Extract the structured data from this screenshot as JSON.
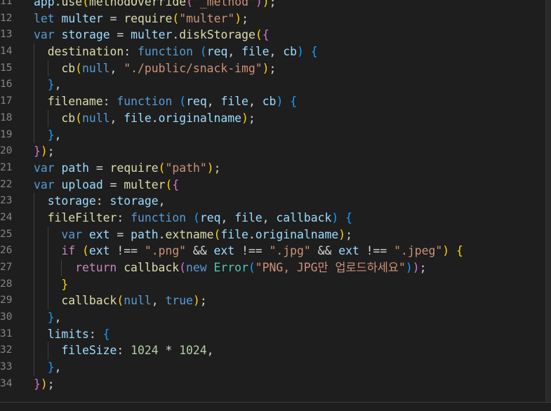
{
  "editor": {
    "lines": [
      {
        "n": "11",
        "indent": 0,
        "tokens": [
          [
            "var",
            "app"
          ],
          [
            "pun",
            "."
          ],
          [
            "fn",
            "use"
          ],
          [
            "b1",
            "("
          ],
          [
            "fn",
            "methodOverride"
          ],
          [
            "b2",
            "("
          ],
          [
            "str",
            "\"_method\""
          ],
          [
            "b2",
            ")"
          ],
          [
            "b1",
            ")"
          ],
          [
            "pun",
            ";"
          ]
        ]
      },
      {
        "n": "12",
        "indent": 0,
        "tokens": [
          [
            "kw",
            "let"
          ],
          [
            "pun",
            " "
          ],
          [
            "var",
            "multer"
          ],
          [
            "pun",
            " = "
          ],
          [
            "fn",
            "require"
          ],
          [
            "b1",
            "("
          ],
          [
            "str",
            "\"multer\""
          ],
          [
            "b1",
            ")"
          ],
          [
            "pun",
            ";"
          ]
        ]
      },
      {
        "n": "13",
        "indent": 0,
        "tokens": [
          [
            "kw",
            "var"
          ],
          [
            "pun",
            " "
          ],
          [
            "var",
            "storage"
          ],
          [
            "pun",
            " = "
          ],
          [
            "var",
            "multer"
          ],
          [
            "pun",
            "."
          ],
          [
            "fn",
            "diskStorage"
          ],
          [
            "b1",
            "("
          ],
          [
            "b2",
            "{"
          ]
        ]
      },
      {
        "n": "14",
        "indent": 1,
        "tokens": [
          [
            "fn",
            "destination"
          ],
          [
            "pun",
            ": "
          ],
          [
            "kw",
            "function"
          ],
          [
            "pun",
            " "
          ],
          [
            "b3",
            "("
          ],
          [
            "var",
            "req"
          ],
          [
            "pun",
            ", "
          ],
          [
            "var",
            "file"
          ],
          [
            "pun",
            ", "
          ],
          [
            "var",
            "cb"
          ],
          [
            "b3",
            ")"
          ],
          [
            "pun",
            " "
          ],
          [
            "b3",
            "{"
          ]
        ]
      },
      {
        "n": "15",
        "indent": 2,
        "tokens": [
          [
            "fn",
            "cb"
          ],
          [
            "b1",
            "("
          ],
          [
            "kw",
            "null"
          ],
          [
            "pun",
            ", "
          ],
          [
            "str",
            "\"./public/snack-img\""
          ],
          [
            "b1",
            ")"
          ],
          [
            "pun",
            ";"
          ]
        ]
      },
      {
        "n": "16",
        "indent": 1,
        "tokens": [
          [
            "b3",
            "}"
          ],
          [
            "pun",
            ","
          ]
        ]
      },
      {
        "n": "17",
        "indent": 1,
        "tokens": [
          [
            "fn",
            "filename"
          ],
          [
            "pun",
            ": "
          ],
          [
            "kw",
            "function"
          ],
          [
            "pun",
            " "
          ],
          [
            "b3",
            "("
          ],
          [
            "var",
            "req"
          ],
          [
            "pun",
            ", "
          ],
          [
            "var",
            "file"
          ],
          [
            "pun",
            ", "
          ],
          [
            "var",
            "cb"
          ],
          [
            "b3",
            ")"
          ],
          [
            "pun",
            " "
          ],
          [
            "b3",
            "{"
          ]
        ]
      },
      {
        "n": "18",
        "indent": 2,
        "tokens": [
          [
            "fn",
            "cb"
          ],
          [
            "b1",
            "("
          ],
          [
            "kw",
            "null"
          ],
          [
            "pun",
            ", "
          ],
          [
            "var",
            "file"
          ],
          [
            "pun",
            "."
          ],
          [
            "var",
            "originalname"
          ],
          [
            "b1",
            ")"
          ],
          [
            "pun",
            ";"
          ]
        ]
      },
      {
        "n": "19",
        "indent": 1,
        "tokens": [
          [
            "b3",
            "}"
          ],
          [
            "pun",
            ","
          ]
        ]
      },
      {
        "n": "20",
        "indent": 0,
        "tokens": [
          [
            "b2",
            "}"
          ],
          [
            "b1",
            ")"
          ],
          [
            "pun",
            ";"
          ]
        ]
      },
      {
        "n": "21",
        "indent": 0,
        "tokens": [
          [
            "kw",
            "var"
          ],
          [
            "pun",
            " "
          ],
          [
            "var",
            "path"
          ],
          [
            "pun",
            " = "
          ],
          [
            "fn",
            "require"
          ],
          [
            "b1",
            "("
          ],
          [
            "str",
            "\"path\""
          ],
          [
            "b1",
            ")"
          ],
          [
            "pun",
            ";"
          ]
        ]
      },
      {
        "n": "22",
        "indent": 0,
        "tokens": [
          [
            "kw",
            "var"
          ],
          [
            "pun",
            " "
          ],
          [
            "var",
            "upload"
          ],
          [
            "pun",
            " = "
          ],
          [
            "fn",
            "multer"
          ],
          [
            "b1",
            "("
          ],
          [
            "b2",
            "{"
          ]
        ]
      },
      {
        "n": "23",
        "indent": 1,
        "tokens": [
          [
            "var",
            "storage"
          ],
          [
            "pun",
            ": "
          ],
          [
            "var",
            "storage"
          ],
          [
            "pun",
            ","
          ]
        ]
      },
      {
        "n": "24",
        "indent": 1,
        "tokens": [
          [
            "fn",
            "fileFilter"
          ],
          [
            "pun",
            ": "
          ],
          [
            "kw",
            "function"
          ],
          [
            "pun",
            " "
          ],
          [
            "b3",
            "("
          ],
          [
            "var",
            "req"
          ],
          [
            "pun",
            ", "
          ],
          [
            "var",
            "file"
          ],
          [
            "pun",
            ", "
          ],
          [
            "var",
            "callback"
          ],
          [
            "b3",
            ")"
          ],
          [
            "pun",
            " "
          ],
          [
            "b3",
            "{"
          ]
        ]
      },
      {
        "n": "25",
        "indent": 2,
        "tokens": [
          [
            "kw",
            "var"
          ],
          [
            "pun",
            " "
          ],
          [
            "var",
            "ext"
          ],
          [
            "pun",
            " = "
          ],
          [
            "var",
            "path"
          ],
          [
            "pun",
            "."
          ],
          [
            "fn",
            "extname"
          ],
          [
            "b1",
            "("
          ],
          [
            "var",
            "file"
          ],
          [
            "pun",
            "."
          ],
          [
            "var",
            "originalname"
          ],
          [
            "b1",
            ")"
          ],
          [
            "pun",
            ";"
          ]
        ]
      },
      {
        "n": "26",
        "indent": 2,
        "tokens": [
          [
            "ctl",
            "if"
          ],
          [
            "pun",
            " "
          ],
          [
            "b1",
            "("
          ],
          [
            "var",
            "ext"
          ],
          [
            "pun",
            " !== "
          ],
          [
            "str",
            "\".png\""
          ],
          [
            "pun",
            " && "
          ],
          [
            "var",
            "ext"
          ],
          [
            "pun",
            " !== "
          ],
          [
            "str",
            "\".jpg\""
          ],
          [
            "pun",
            " && "
          ],
          [
            "var",
            "ext"
          ],
          [
            "pun",
            " !== "
          ],
          [
            "str",
            "\".jpeg\""
          ],
          [
            "b1",
            ")"
          ],
          [
            "pun",
            " "
          ],
          [
            "b1",
            "{"
          ]
        ]
      },
      {
        "n": "27",
        "indent": 3,
        "tokens": [
          [
            "ctl",
            "return"
          ],
          [
            "pun",
            " "
          ],
          [
            "fn",
            "callback"
          ],
          [
            "b2",
            "("
          ],
          [
            "kw",
            "new"
          ],
          [
            "pun",
            " "
          ],
          [
            "cls",
            "Error"
          ],
          [
            "b3",
            "("
          ],
          [
            "str",
            "\"PNG, JPG만 업로드하세요\""
          ],
          [
            "b3",
            ")"
          ],
          [
            "b2",
            ")"
          ],
          [
            "pun",
            ";"
          ]
        ]
      },
      {
        "n": "28",
        "indent": 2,
        "tokens": [
          [
            "b1",
            "}"
          ]
        ]
      },
      {
        "n": "29",
        "indent": 2,
        "tokens": [
          [
            "fn",
            "callback"
          ],
          [
            "b1",
            "("
          ],
          [
            "kw",
            "null"
          ],
          [
            "pun",
            ", "
          ],
          [
            "kw",
            "true"
          ],
          [
            "b1",
            ")"
          ],
          [
            "pun",
            ";"
          ]
        ]
      },
      {
        "n": "30",
        "indent": 1,
        "tokens": [
          [
            "b3",
            "}"
          ],
          [
            "pun",
            ","
          ]
        ]
      },
      {
        "n": "31",
        "indent": 1,
        "tokens": [
          [
            "var",
            "limits"
          ],
          [
            "pun",
            ": "
          ],
          [
            "b3",
            "{"
          ]
        ]
      },
      {
        "n": "32",
        "indent": 2,
        "tokens": [
          [
            "var",
            "fileSize"
          ],
          [
            "pun",
            ": "
          ],
          [
            "num",
            "1024"
          ],
          [
            "pun",
            " * "
          ],
          [
            "num",
            "1024"
          ],
          [
            "pun",
            ","
          ]
        ]
      },
      {
        "n": "33",
        "indent": 1,
        "tokens": [
          [
            "b3",
            "}"
          ],
          [
            "pun",
            ","
          ]
        ]
      },
      {
        "n": "34",
        "indent": 0,
        "tokens": [
          [
            "b2",
            "}"
          ],
          [
            "b1",
            ")"
          ],
          [
            "pun",
            ";"
          ]
        ]
      }
    ]
  },
  "colors": {
    "background": "#1e1e1e",
    "line_number": "#858585",
    "keyword": "#569cd6",
    "control": "#c586c0",
    "variable": "#9cdcfe",
    "function": "#dcdcaa",
    "string": "#ce9178",
    "number": "#b5cea8",
    "class": "#4ec9b0"
  }
}
